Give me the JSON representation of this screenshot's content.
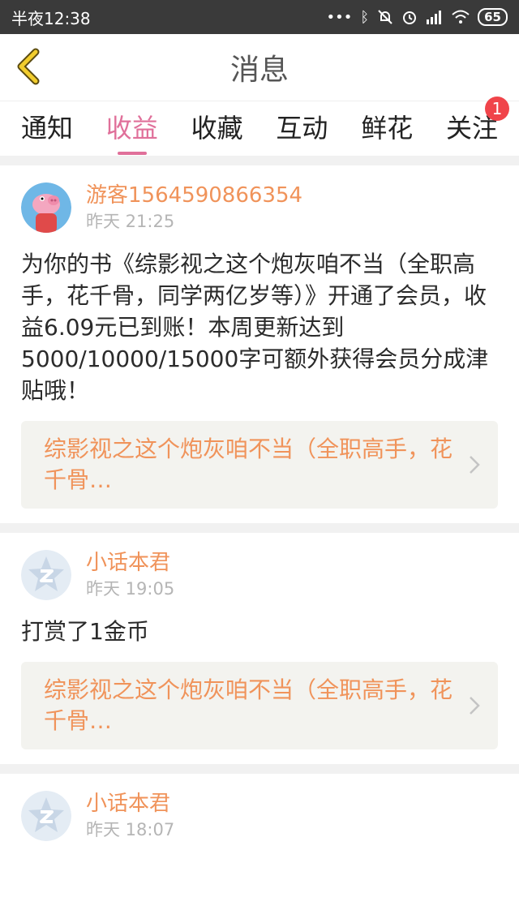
{
  "status_bar": {
    "time": "半夜12:38",
    "battery": "65"
  },
  "header": {
    "title": "消息"
  },
  "tabs": [
    {
      "label": "通知"
    },
    {
      "label": "收益"
    },
    {
      "label": "收藏"
    },
    {
      "label": "互动"
    },
    {
      "label": "鲜花"
    },
    {
      "label": "关注",
      "badge": "1"
    }
  ],
  "active_tab": "收益",
  "messages": [
    {
      "sender": "游客1564590866354",
      "time": "昨天 21:25",
      "body": "为你的书《综影视之这个炮灰咱不当（全职高手，花千骨，同学两亿岁等）》开通了会员，收益6.09元已到账！本周更新达到5000/10000/15000字可额外获得会员分成津贴哦！",
      "book_link": "综影视之这个炮灰咱不当（全职高手，花千骨…"
    },
    {
      "sender": "小话本君",
      "time": "昨天 19:05",
      "body": "打赏了1金币",
      "book_link": "综影视之这个炮灰咱不当（全职高手，花千骨…"
    },
    {
      "sender": "小话本君",
      "time": "昨天 18:07"
    }
  ],
  "colors": {
    "accent": "#e0709a",
    "sender": "#f0935a",
    "badge": "#f0444a"
  },
  "icons": [
    "back-arrow-icon",
    "bluetooth-icon",
    "mute-icon",
    "alarm-icon",
    "signal-icon",
    "wifi-icon",
    "chevron-right-icon"
  ]
}
